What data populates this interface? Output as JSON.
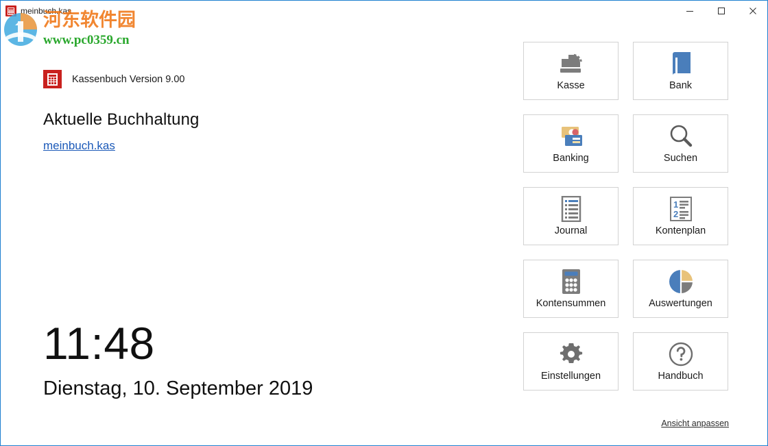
{
  "window": {
    "title": "meinbuch.kas",
    "title_icon": "calculator-icon",
    "accent_border": "#1d7fd0",
    "controls": {
      "minimize": "minimize-icon",
      "maximize": "maximize-icon",
      "close": "close-icon"
    }
  },
  "watermark": {
    "site_cn": "河东软件园",
    "site_url": "www.pc0359.cn",
    "logo_digit": "1",
    "colors": {
      "blue": "#3fa9e0",
      "orange": "#f0912d",
      "green": "#17a01a",
      "text_orange": "#f07818"
    }
  },
  "left": {
    "version_label": "Kassenbuch Version 9.00",
    "version_icon": "calculator-icon",
    "heading": "Aktuelle Buchhaltung",
    "file_link": "meinbuch.kas",
    "clock_time": "11:48",
    "clock_date": "Dienstag, 10. September 2019"
  },
  "tiles": [
    {
      "label": "Kasse",
      "icon": "cash-register-icon"
    },
    {
      "label": "Bank",
      "icon": "book-icon"
    },
    {
      "label": "Banking",
      "icon": "payment-cards-icon"
    },
    {
      "label": "Suchen",
      "icon": "magnifier-icon"
    },
    {
      "label": "Journal",
      "icon": "document-list-icon"
    },
    {
      "label": "Kontenplan",
      "icon": "numbered-list-icon"
    },
    {
      "label": "Kontensummen",
      "icon": "calculator-icon"
    },
    {
      "label": "Auswertungen",
      "icon": "pie-chart-icon"
    },
    {
      "label": "Einstellungen",
      "icon": "gear-icon"
    },
    {
      "label": "Handbuch",
      "icon": "question-mark-icon"
    }
  ],
  "footer": {
    "adjust_view_link": "Ansicht anpassen"
  },
  "colors": {
    "tile_border": "#d2d2d2",
    "icon_gray": "#7c7c7c",
    "icon_blue": "#4a7ebb",
    "icon_tan": "#e8c27a",
    "link_blue": "#1b59b8",
    "brand_red": "#c9211e"
  }
}
